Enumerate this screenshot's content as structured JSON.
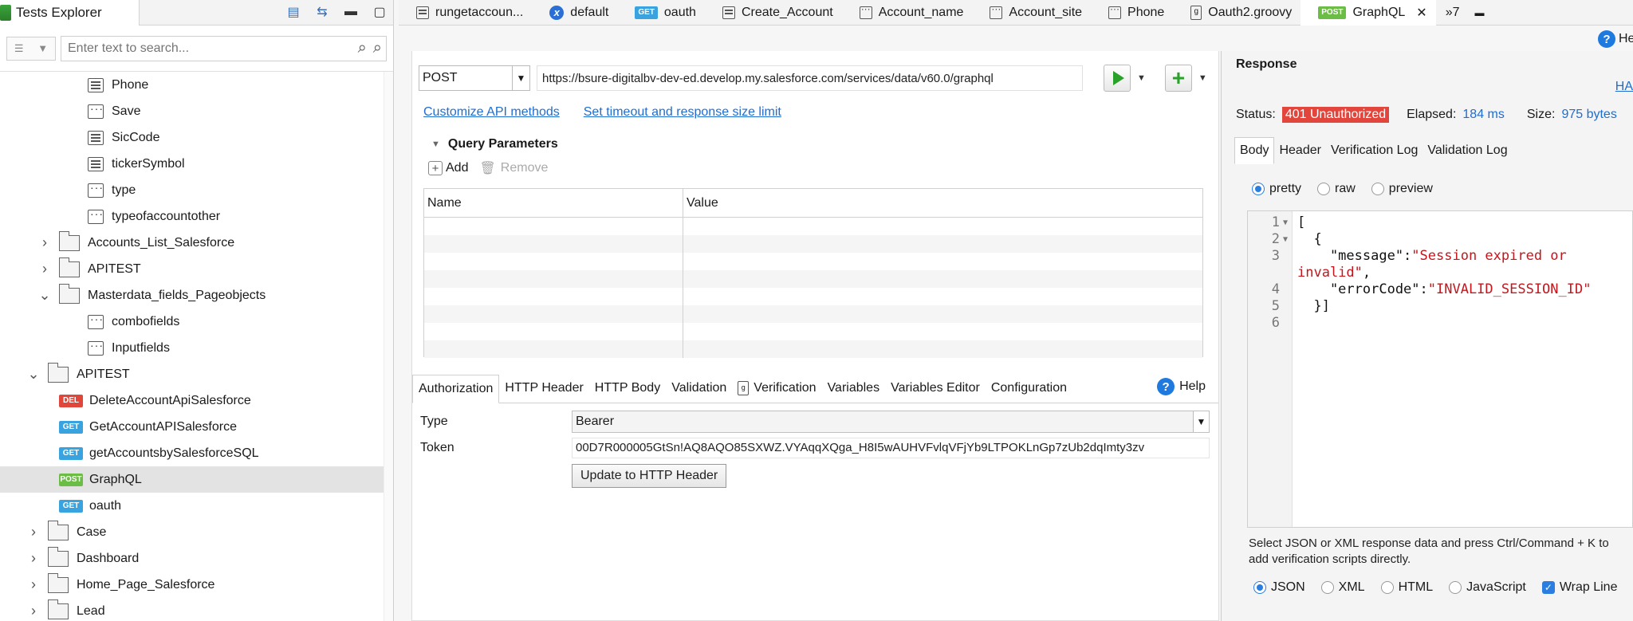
{
  "left_panel": {
    "title": "Tests Explorer",
    "search_placeholder": "Enter text to search...",
    "tree": [
      {
        "label": "Phone",
        "indent": 3,
        "icon": "lines"
      },
      {
        "label": "Save",
        "indent": 3,
        "icon": "dots"
      },
      {
        "label": "SicCode",
        "indent": 3,
        "icon": "lines"
      },
      {
        "label": "tickerSymbol",
        "indent": 3,
        "icon": "lines"
      },
      {
        "label": "type",
        "indent": 3,
        "icon": "dots"
      },
      {
        "label": "typeofaccountother",
        "indent": 3,
        "icon": "dots"
      },
      {
        "label": "Accounts_List_Salesforce",
        "indent": 2,
        "icon": "folder",
        "chevron": "›"
      },
      {
        "label": "APITEST",
        "indent": 2,
        "icon": "folder",
        "chevron": "›"
      },
      {
        "label": "Masterdata_fields_Pageobjects",
        "indent": 2,
        "icon": "folder",
        "chevron": "⌄"
      },
      {
        "label": "combofields",
        "indent": 3,
        "icon": "dots"
      },
      {
        "label": "Inputfields",
        "indent": 3,
        "icon": "dots"
      },
      {
        "label": "APITEST",
        "indent": 1,
        "icon": "folder",
        "chevron": "⌄"
      },
      {
        "label": "DeleteAccountApiSalesforce",
        "indent": 2,
        "badge": "DEL"
      },
      {
        "label": "GetAccountAPISalesforce",
        "indent": 2,
        "badge": "GET"
      },
      {
        "label": "getAccountsbySalesforceSQL",
        "indent": 2,
        "badge": "GET"
      },
      {
        "label": "GraphQL",
        "indent": 2,
        "badge": "POST",
        "selected": true
      },
      {
        "label": "oauth",
        "indent": 2,
        "badge": "GET"
      },
      {
        "label": "Case",
        "indent": 1,
        "icon": "folder",
        "chevron": "›"
      },
      {
        "label": "Dashboard",
        "indent": 1,
        "icon": "folder",
        "chevron": "›"
      },
      {
        "label": "Home_Page_Salesforce",
        "indent": 1,
        "icon": "folder",
        "chevron": "›"
      },
      {
        "label": "Lead",
        "indent": 1,
        "icon": "folder",
        "chevron": "›"
      }
    ]
  },
  "tabs": [
    {
      "label": "rungetaccoun...",
      "icon": "grid"
    },
    {
      "label": "default",
      "icon": "x"
    },
    {
      "label": "oauth",
      "icon": "GET"
    },
    {
      "label": "Create_Account",
      "icon": "grid"
    },
    {
      "label": "Account_name",
      "icon": "dots"
    },
    {
      "label": "Account_site",
      "icon": "dots"
    },
    {
      "label": "Phone",
      "icon": "dots"
    },
    {
      "label": "Oauth2.groovy",
      "icon": "groovy"
    },
    {
      "label": "GraphQL",
      "icon": "POST",
      "active": true
    }
  ],
  "tab_overflow": "»7",
  "request": {
    "method": "POST",
    "url": "https://bsure-digitalbv-dev-ed.develop.my.salesforce.com/services/data/v60.0/graphql",
    "link_customize": "Customize API methods",
    "link_timeout": "Set timeout and response size limit"
  },
  "query_params": {
    "title": "Query Parameters",
    "add_label": "Add",
    "remove_label": "Remove",
    "col_name": "Name",
    "col_value": "Value"
  },
  "auth_tabs": [
    "Authorization",
    "HTTP Header",
    "HTTP Body",
    "Validation",
    "Verification",
    "Variables",
    "Variables Editor",
    "Configuration"
  ],
  "help_label": "Help",
  "auth": {
    "type_label": "Type",
    "type_value": "Bearer",
    "token_label": "Token",
    "token_value": "00D7R000005GtSn!AQ8AQO85SXWZ.VYAqqXQga_H8I5wAUHVFvlqVFjYb9LTPOKLnGp7zUb2dqImty3zv",
    "update_button": "Update to HTTP Header"
  },
  "response": {
    "title": "Response",
    "top_right_link": "HA",
    "status_label": "Status:",
    "status_value": "401 Unauthorized",
    "elapsed_label": "Elapsed:",
    "elapsed_value": "184 ms",
    "size_label": "Size:",
    "size_value": "975 bytes",
    "tabs": [
      "Body",
      "Header",
      "Verification Log",
      "Validation Log"
    ],
    "view_options": [
      "pretty",
      "raw",
      "preview"
    ],
    "hint": "Select JSON or XML response data and press Ctrl/Command + K to add verification scripts directly.",
    "formats": [
      "JSON",
      "XML",
      "HTML",
      "JavaScript"
    ],
    "wrap_label": "Wrap Line",
    "help_label": "He"
  },
  "code": {
    "line1": "[",
    "line2": "  {",
    "line3_key": "    \"message\":",
    "line3_val": "\"Session expired or",
    "line3_cont": "invalid\"",
    "line4_key": "    \"errorCode\":",
    "line4_val": "\"INVALID_SESSION_ID\"",
    "line5": "  }]",
    "ln": [
      "1",
      "2",
      "3",
      "4",
      "5",
      "6"
    ]
  },
  "colors": {
    "accent": "#1f6dd0",
    "status_error": "#e2453c",
    "post_badge": "#6cbd45",
    "get_badge": "#39a3e0",
    "del_badge": "#e0463a"
  }
}
